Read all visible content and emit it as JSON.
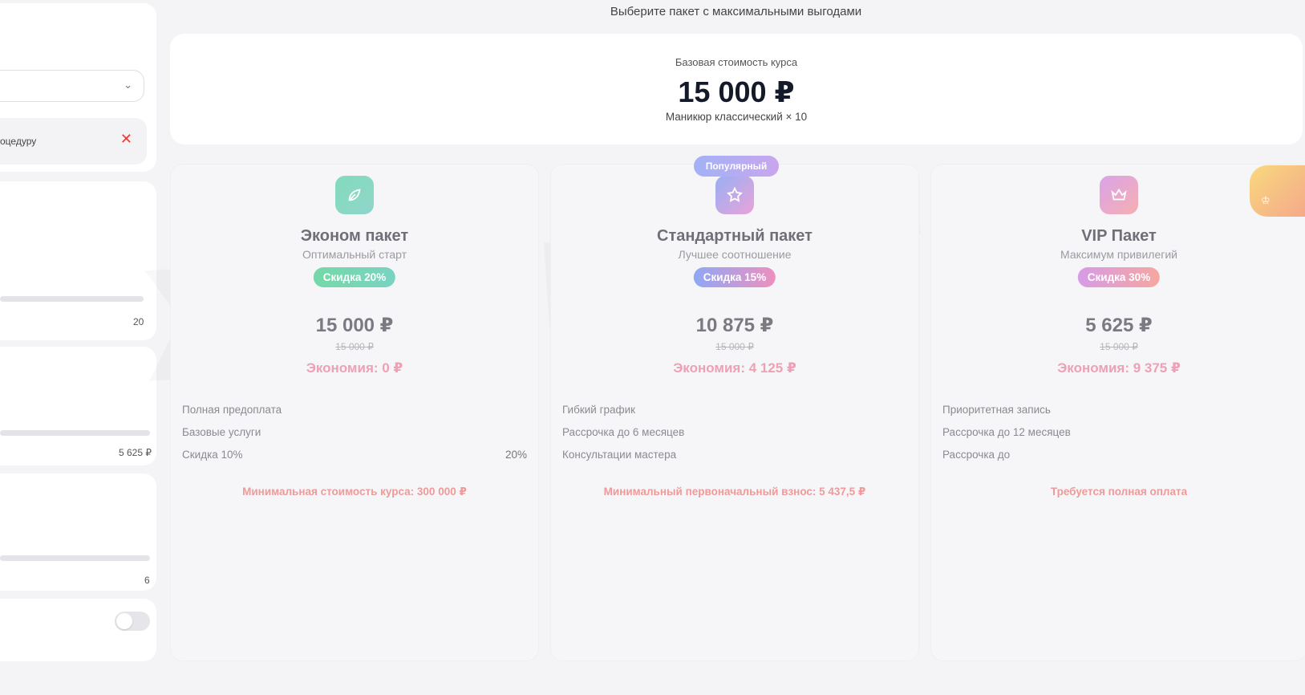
{
  "sidebar": {
    "procedure_text": "оцедуру",
    "remove_icon": "close-icon",
    "slider1_value": "20",
    "slider2_value": "5 625 ₽",
    "slider3_value": "6"
  },
  "header": {
    "subtitle": "Выберите пакет с максимальными выгодами"
  },
  "base": {
    "label": "Базовая стоимость курса",
    "price": "15 000 ₽",
    "description": "Маникюр классический × 10"
  },
  "watermark": "ЖЕНИЕ ТО СТЕ",
  "popular_badge": "Популярный",
  "packages": [
    {
      "icon": "leaf-icon",
      "name": "Эконом пакет",
      "tagline": "Оптимальный старт",
      "discount": "Скидка 20%",
      "price": "15 000 ₽",
      "old_price": "15 000 ₽",
      "saving": "Экономия: 0 ₽",
      "features": [
        "Полная предоплата",
        "Базовые услуги",
        "Скидка 10%"
      ],
      "feature_value": "20%",
      "note": "Минимальная стоимость курса: 300 000 ₽"
    },
    {
      "icon": "star-icon",
      "name": "Стандартный пакет",
      "tagline": "Лучшее соотношение",
      "discount": "Скидка 15%",
      "price": "10 875 ₽",
      "old_price": "15 000 ₽",
      "saving": "Экономия: 4 125 ₽",
      "features": [
        "Гибкий график",
        "Рассрочка до 6 месяцев",
        "Консультации мастера"
      ],
      "note": "Минимальный первоначальный взнос: 5 437,5 ₽"
    },
    {
      "icon": "crown-icon",
      "name": "VIP Пакет",
      "tagline": "Максимум привилегий",
      "discount": "Скидка 30%",
      "price": "5 625 ₽",
      "old_price": "15 000 ₽",
      "saving": "Экономия: 9 375 ₽",
      "features": [
        "Приоритетная запись",
        "Рассрочка до 12 месяцев",
        "Рассрочка до"
      ],
      "note": "Требуется полная оплата"
    }
  ],
  "colors": {
    "background": "#f4f4f6",
    "saving": "#eea0b4",
    "note": "#ef9a9a",
    "remove": "#e53935"
  }
}
